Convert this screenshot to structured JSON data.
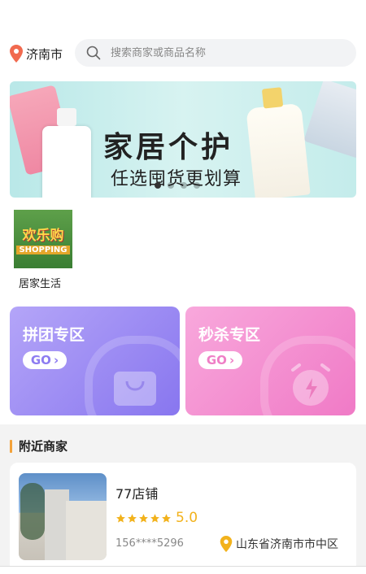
{
  "header": {
    "city": "济南市",
    "search_placeholder": "搜索商家或商品名称"
  },
  "banner": {
    "title": "家居个护",
    "subtitle": "任选囤货更划算",
    "dots_count": 4,
    "active_dot": 0
  },
  "categories": [
    {
      "label": "居家生活",
      "image_text_top": "欢乐购",
      "image_text_bottom": "SHOPPING"
    }
  ],
  "promos": [
    {
      "title": "拼团专区",
      "go_label": "GO",
      "color": "#9a8af3"
    },
    {
      "title": "秒杀专区",
      "go_label": "GO",
      "color": "#f48ed0"
    }
  ],
  "nearby": {
    "heading": "附近商家",
    "accent_color": "#f3a23a",
    "shops": [
      {
        "name": "77店铺",
        "stars": 5,
        "rating": "5.0",
        "phone": "156****5296",
        "address": "山东省济南市市中区"
      }
    ]
  }
}
